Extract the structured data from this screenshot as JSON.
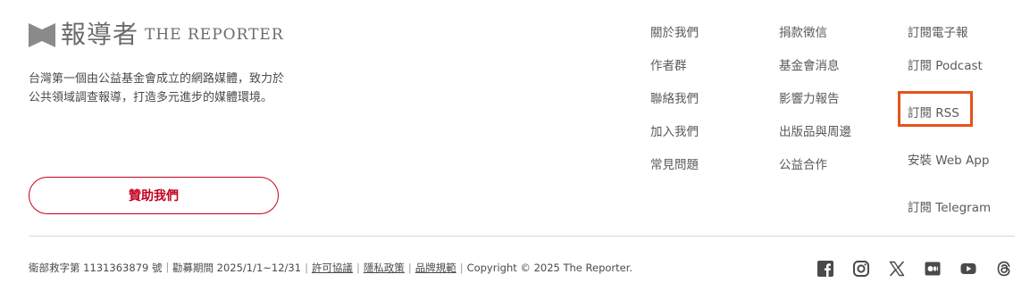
{
  "logo": {
    "cn": "報導者",
    "en": "THE REPORTER"
  },
  "description": [
    "台灣第一個由公益基金會成立的網路媒體，致力於",
    "公共領域調查報導，打造多元進步的媒體環境。"
  ],
  "donate_label": "贊助我們",
  "col1": [
    "關於我們",
    "作者群",
    "聯絡我們",
    "加入我們",
    "常見問題"
  ],
  "col2": [
    "捐款徵信",
    "基金會消息",
    "影響力報告",
    "出版品與周邊",
    "公益合作"
  ],
  "col3": [
    "訂閱電子報",
    "訂閱 Podcast",
    "訂閱 RSS",
    "安裝 Web App",
    "訂閱 Telegram"
  ],
  "footer": {
    "license": "衛部救字第 1131363879 號｜勸募期間 2025/1/1~12/31",
    "sep": "|",
    "links": [
      "許可協議",
      "隱私政策",
      "品牌規範"
    ],
    "copyright": "Copyright © 2025 The Reporter."
  },
  "social_icons": [
    "facebook-icon",
    "instagram-icon",
    "x-icon",
    "medium-icon",
    "youtube-icon",
    "threads-icon"
  ],
  "colors": {
    "accent": "#c4001f",
    "highlight": "#e8521c",
    "text": "#4a4a4a",
    "logo_gray": "#6b6b6b"
  }
}
